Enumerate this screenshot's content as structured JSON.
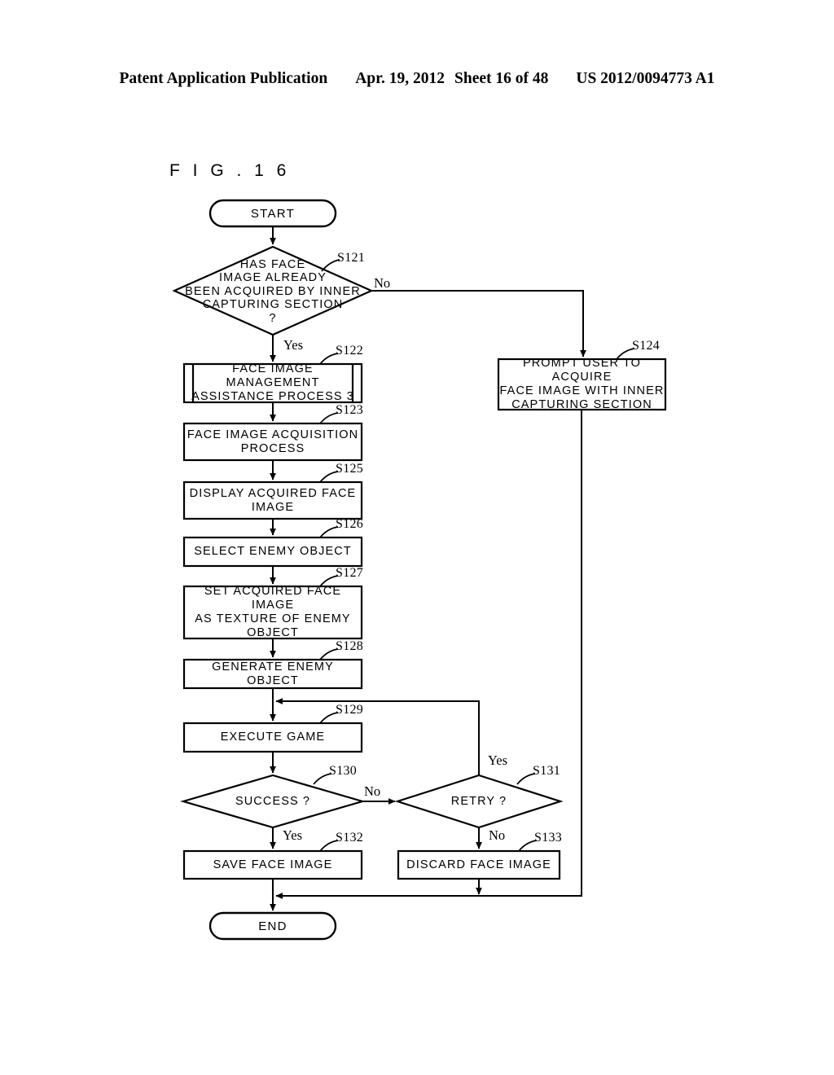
{
  "header": {
    "publication": "Patent Application Publication",
    "date": "Apr. 19, 2012",
    "sheet": "Sheet 16 of 48",
    "patent_number": "US 2012/0094773 A1"
  },
  "figure": {
    "title": "F I G .   1 6"
  },
  "flowchart": {
    "nodes": {
      "start": {
        "label": "START",
        "shape": "terminator"
      },
      "s121": {
        "tag": "S121",
        "label": "HAS FACE\nIMAGE ALREADY\nBEEN ACQUIRED BY INNER\nCAPTURING SECTION\n?",
        "shape": "decision"
      },
      "s122": {
        "tag": "S122",
        "label": "FACE IMAGE MANAGEMENT\nASSISTANCE PROCESS 3",
        "shape": "predefined-process"
      },
      "s123": {
        "tag": "S123",
        "label": "FACE IMAGE ACQUISITION\nPROCESS",
        "shape": "process"
      },
      "s124": {
        "tag": "S124",
        "label": "PROMPT USER TO ACQUIRE\nFACE IMAGE WITH INNER\nCAPTURING SECTION",
        "shape": "process"
      },
      "s125": {
        "tag": "S125",
        "label": "DISPLAY ACQUIRED FACE\nIMAGE",
        "shape": "process"
      },
      "s126": {
        "tag": "S126",
        "label": "SELECT ENEMY OBJECT",
        "shape": "process"
      },
      "s127": {
        "tag": "S127",
        "label": "SET ACQUIRED FACE IMAGE\nAS TEXTURE OF ENEMY\nOBJECT",
        "shape": "process"
      },
      "s128": {
        "tag": "S128",
        "label": "GENERATE ENEMY OBJECT",
        "shape": "process"
      },
      "s129": {
        "tag": "S129",
        "label": "EXECUTE GAME",
        "shape": "process"
      },
      "s130": {
        "tag": "S130",
        "label": "SUCCESS ?",
        "shape": "decision"
      },
      "s131": {
        "tag": "S131",
        "label": "RETRY ?",
        "shape": "decision"
      },
      "s132": {
        "tag": "S132",
        "label": "SAVE FACE IMAGE",
        "shape": "process"
      },
      "s133": {
        "tag": "S133",
        "label": "DISCARD FACE IMAGE",
        "shape": "process"
      },
      "end": {
        "label": "END",
        "shape": "terminator"
      }
    },
    "branch_labels": {
      "s121_no": "No",
      "s121_yes": "Yes",
      "s130_no": "No",
      "s130_yes": "Yes",
      "s131_yes": "Yes",
      "s131_no": "No"
    }
  }
}
